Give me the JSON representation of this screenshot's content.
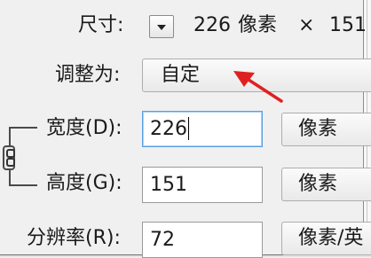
{
  "size": {
    "label": "尺寸:",
    "width": "226",
    "unit": "像素",
    "times": "×",
    "height_partial": "151"
  },
  "adjust": {
    "label": "调整为:",
    "value": "自定"
  },
  "width_row": {
    "label": "宽度(D):",
    "value": "226",
    "unit": "像素"
  },
  "height_row": {
    "label": "高度(G):",
    "value": "151",
    "unit": "像素"
  },
  "resolution_row": {
    "label": "分辨率(R):",
    "value": "72",
    "unit": "像素/英"
  },
  "annotation": {
    "arrow_color": "#e02020"
  },
  "icons": [
    "chevron-down-icon",
    "link-icon",
    "red-arrow-annotation-icon"
  ]
}
